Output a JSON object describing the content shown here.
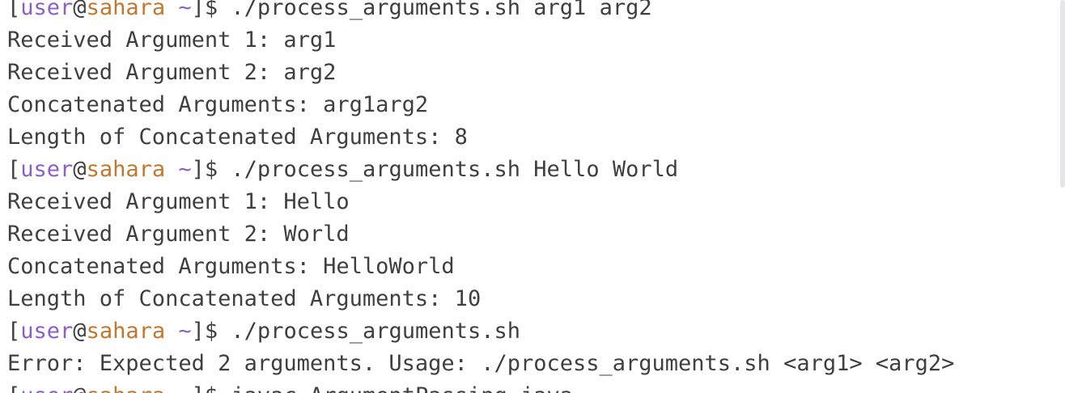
{
  "prompt": {
    "open_bracket": "[",
    "user": "user",
    "at": "@",
    "host": "sahara",
    "space": " ",
    "tilde": "~",
    "close_bracket": "]",
    "dollar": "$ "
  },
  "colors": {
    "user": "#8b5fc4",
    "host": "#c0782e",
    "text": "#3f3f3f",
    "background": "#ffffff"
  },
  "lines": [
    {
      "type": "prompt",
      "command": "./process_arguments.sh arg1 arg2"
    },
    {
      "type": "output",
      "text": "Received Argument 1: arg1"
    },
    {
      "type": "output",
      "text": "Received Argument 2: arg2"
    },
    {
      "type": "output",
      "text": "Concatenated Arguments: arg1arg2"
    },
    {
      "type": "output",
      "text": "Length of Concatenated Arguments: 8"
    },
    {
      "type": "prompt",
      "command": "./process_arguments.sh Hello World"
    },
    {
      "type": "output",
      "text": "Received Argument 1: Hello"
    },
    {
      "type": "output",
      "text": "Received Argument 2: World"
    },
    {
      "type": "output",
      "text": "Concatenated Arguments: HelloWorld"
    },
    {
      "type": "output",
      "text": "Length of Concatenated Arguments: 10"
    },
    {
      "type": "prompt",
      "command": "./process_arguments.sh"
    },
    {
      "type": "output",
      "text": "Error: Expected 2 arguments. Usage: ./process_arguments.sh <arg1> <arg2>"
    },
    {
      "type": "prompt",
      "command": "javac ArgumentPassing.java"
    }
  ]
}
